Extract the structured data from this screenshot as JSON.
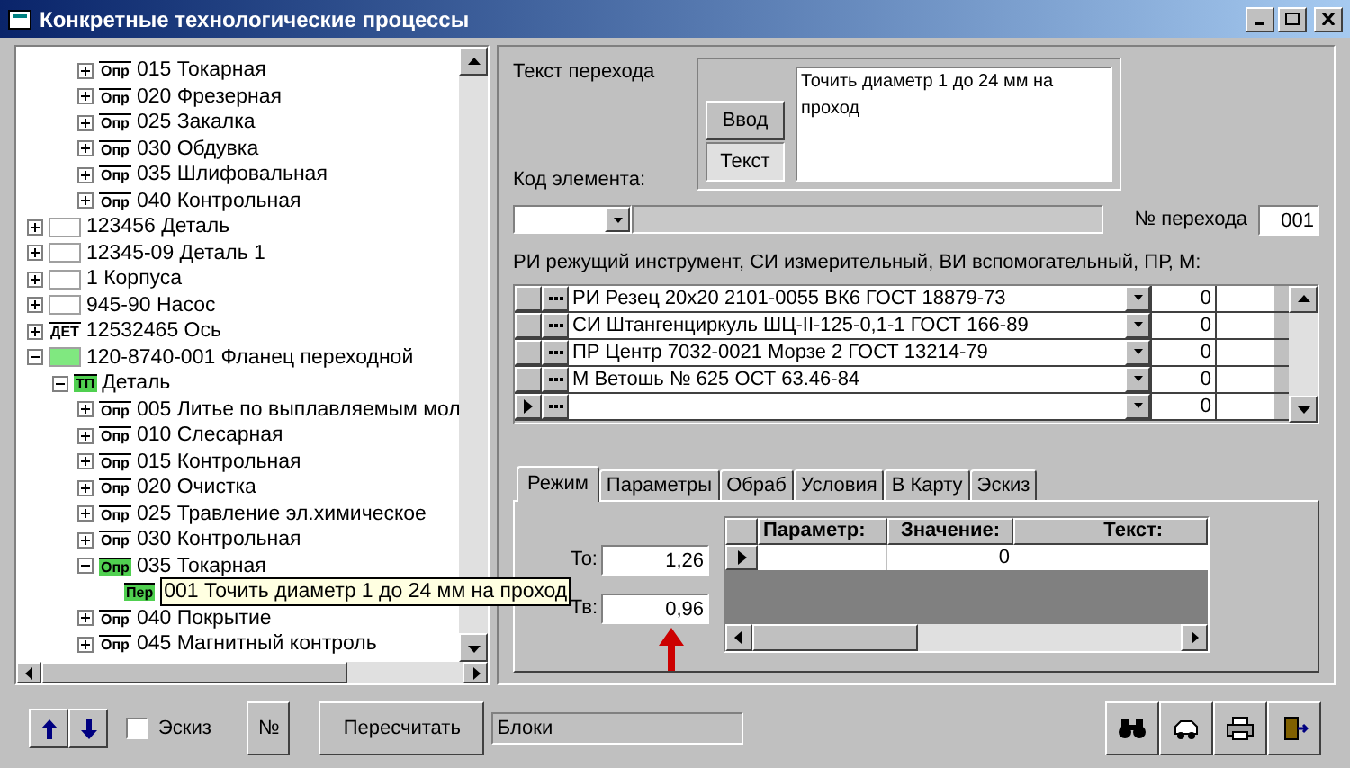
{
  "window": {
    "title": "Конкретные технологические процессы"
  },
  "tree": {
    "items": [
      {
        "children": [
          {
            "children": [
              {
                "label": "015 Токарная",
                "badge": "Опр",
                "expanded": false
              },
              {
                "label": "020 Фрезерная",
                "badge": "Опр",
                "expanded": false
              },
              {
                "label": "025 Закалка",
                "badge": "Опр",
                "expanded": false
              },
              {
                "label": "030 Обдувка",
                "badge": "Опр",
                "expanded": false
              },
              {
                "label": "035 Шлифовальная",
                "badge": "Опр",
                "expanded": false
              },
              {
                "label": "040 Контрольная",
                "badge": "Опр",
                "expanded": false
              }
            ]
          }
        ]
      },
      {
        "label": "123456 Деталь",
        "expanded": false
      },
      {
        "label": "12345-09 Деталь 1",
        "expanded": false
      },
      {
        "label": "1 Корпуса",
        "expanded": false
      },
      {
        "label": "945-90 Насос",
        "expanded": false
      },
      {
        "label": "12532465 Ось",
        "badge": "ДЕТ",
        "expanded": false
      },
      {
        "label": "120-8740-001 Фланец переходной",
        "color": "#80e880",
        "expanded": true,
        "children": [
          {
            "label": "Деталь",
            "badge": "ТП",
            "color": "#50d050",
            "expanded": true,
            "children": [
              {
                "label": "005 Литье по выплавляемым мол",
                "badge": "Опр",
                "expanded": false
              },
              {
                "label": "010 Слесарная",
                "badge": "Опр",
                "expanded": false
              },
              {
                "label": "015 Контрольная",
                "badge": "Опр",
                "expanded": false
              },
              {
                "label": "020 Очистка",
                "badge": "Опр",
                "expanded": false
              },
              {
                "label": "025 Травление эл.химическое",
                "badge": "Опр",
                "expanded": false
              },
              {
                "label": "030 Контрольная",
                "badge": "Опр",
                "expanded": false
              },
              {
                "label": "035 Токарная",
                "badge": "Опр",
                "color": "#50d050",
                "expanded": true,
                "children": [
                  {
                    "label": "001 Точить диаметр 1 до 24 мм на проход",
                    "badge": "Пер",
                    "color": "#50d050",
                    "hovered": true
                  }
                ]
              },
              {
                "label": "040 Покрытие",
                "badge": "Опр",
                "expanded": false
              },
              {
                "label": "045 Магнитный контроль",
                "badge": "Опр",
                "expanded": false
              }
            ]
          }
        ]
      }
    ]
  },
  "transition": {
    "label": "Текст перехода",
    "buttons": [
      {
        "label": "Ввод",
        "selected": false
      },
      {
        "label": "Текст",
        "selected": true
      }
    ],
    "text": "Точить диаметр 1 до 24 мм на проход"
  },
  "element_code": {
    "label": "Код элемента:"
  },
  "transition_number": {
    "label": "№ перехода",
    "value": "001"
  },
  "tools": {
    "label": "РИ режущий инструмент, СИ измерительный, ВИ вспомогательный, ПР, М:",
    "rows": [
      {
        "text": "РИ Резец 20х20 2101-0055 ВК6 ГОСТ 18879-73",
        "value": "0",
        "current": false
      },
      {
        "text": "СИ Штангенциркуль ШЦ-II-125-0,1-1 ГОСТ 166-89",
        "value": "0",
        "current": false
      },
      {
        "text": "ПР Центр 7032-0021 Морзе 2 ГОСТ 13214-79",
        "value": "0",
        "current": false
      },
      {
        "text": "М Ветошь № 625 ОСТ 63.46-84",
        "value": "0",
        "current": false
      },
      {
        "value": "0",
        "current": true
      }
    ]
  },
  "tabs": [
    {
      "label": "Режим",
      "selected": true
    },
    {
      "label": "Параметры",
      "selected": false
    },
    {
      "label": "Обраб",
      "selected": false
    },
    {
      "label": "Условия",
      "selected": false
    },
    {
      "label": "В Карту",
      "selected": false
    },
    {
      "label": "Эскиз",
      "selected": false
    }
  ],
  "mode": {
    "fields": [
      {
        "label": "То:",
        "value": "1,26"
      },
      {
        "label": "Тв:",
        "value": "0,96"
      }
    ],
    "table": {
      "columns": [
        "Параметр:",
        "Значение:",
        "Текст:"
      ],
      "rows": [
        {
          "value": "0",
          "current": true
        }
      ]
    }
  },
  "bottom": {
    "sketch": {
      "label": "Эскиз",
      "checked": false
    },
    "number_button": "№",
    "recalc_button": "Пересчитать",
    "blocks_field": "Блоки"
  }
}
